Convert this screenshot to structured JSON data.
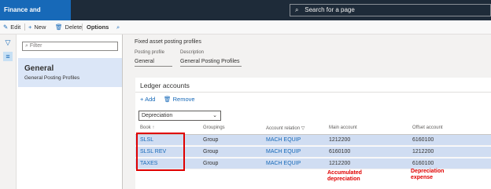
{
  "topbar": {
    "app_title": "Finance and Operations",
    "search_placeholder": "Search for a page"
  },
  "actions": {
    "edit": "Edit",
    "new": "New",
    "delete": "Delete",
    "options": "Options"
  },
  "list": {
    "filter_placeholder": "Filter",
    "selected_title": "General",
    "selected_subtitle": "General Posting Profiles"
  },
  "detail": {
    "breadcrumb": "Fixed asset posting profiles",
    "posting_profile_label": "Posting profile",
    "posting_profile_value": "General",
    "description_label": "Description",
    "description_value": "General Posting Profiles"
  },
  "ledger": {
    "title": "Ledger accounts",
    "add": "Add",
    "remove": "Remove",
    "dropdown_value": "Depreciation",
    "columns": {
      "book": "Book",
      "groupings": "Groupings",
      "account_relation": "Account relation",
      "main_account": "Main account",
      "offset_account": "Offset account"
    },
    "rows": [
      {
        "book": "SLSL",
        "grouping": "Group",
        "relation": "MACH EQUIP",
        "main": "1212200",
        "offset": "6160100"
      },
      {
        "book": "SLSL REV",
        "grouping": "Group",
        "relation": "MACH EQUIP",
        "main": "6160100",
        "offset": "1212200"
      },
      {
        "book": "TAXES",
        "grouping": "Group",
        "relation": "MACH EQUIP",
        "main": "1212200",
        "offset": "6160100"
      }
    ]
  },
  "annotations": {
    "main_line1": "Accumulated",
    "main_line2": "depreciation",
    "offset_line1": "Depreciation",
    "offset_line2": "expense"
  },
  "colors": {
    "brand": "#1769b8",
    "topbar": "#1e2b39",
    "row_selected": "#d0ddf2",
    "annotation": "#e00000"
  }
}
